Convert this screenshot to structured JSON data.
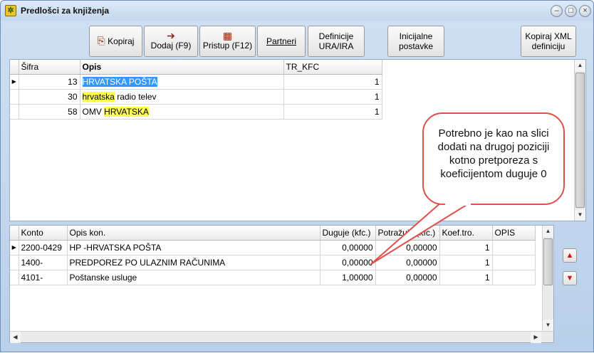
{
  "window": {
    "title": "Predlošci za knjiženja"
  },
  "toolbar": {
    "kopiraj": "Kopiraj",
    "dodaj": "Dodaj (F9)",
    "pristup": "Pristup (F12)",
    "partneri": "Partneri",
    "definicije_1": "Definicije",
    "definicije_2": "URA/IRA",
    "inicijalne_1": "Inicijalne",
    "inicijalne_2": "postavke",
    "kopiraj_xml_1": "Kopiraj XML",
    "kopiraj_xml_2": "definiciju"
  },
  "top_grid": {
    "columns": [
      "Šifra",
      "Opis",
      "TR_KFC"
    ],
    "rows": [
      {
        "sifra": "13",
        "opis": "HRVATSKA POŠTA",
        "opis_hl": "HRVATSKA POŠTA",
        "opis_rest": "",
        "tr_kfc": "1",
        "current": true
      },
      {
        "sifra": "30",
        "opis": "hrvatska radio telev",
        "opis_pre": "",
        "opis_hl": "hrvatska",
        "opis_rest": " radio telev",
        "tr_kfc": "1"
      },
      {
        "sifra": "58",
        "opis": "OMV HRVATSKA",
        "opis_pre": "OMV ",
        "opis_hl": "HRVATSKA",
        "opis_rest": "",
        "tr_kfc": "1"
      }
    ]
  },
  "bottom_grid": {
    "columns": [
      "Konto",
      "Opis kon.",
      "Duguje (kfc.)",
      "Potražuje (kfc.)",
      "Koef.tro.",
      "OPIS"
    ],
    "rows": [
      {
        "konto": "2200-0429",
        "opis": "HP -HRVATSKA POŠTA",
        "duguje": "0,00000",
        "potrazuje": "0,00000",
        "koef": "1",
        "opis2": ""
      },
      {
        "konto": "1400-",
        "opis": "PREDPOREZ PO ULAZNIM RAČUNIMA",
        "duguje": "0,00000",
        "potrazuje": "0,00000",
        "koef": "1",
        "opis2": ""
      },
      {
        "konto": "4101-",
        "opis": "Poštanske usluge",
        "duguje": "1,00000",
        "potrazuje": "0,00000",
        "koef": "1",
        "opis2": ""
      }
    ]
  },
  "callout": {
    "text": "Potrebno je kao na slici dodati na drugoj poziciji kotno pretporeza s koeficijentom duguje 0"
  },
  "colors": {
    "accent_border": "#e0504a",
    "selection": "#3399ff",
    "search_highlight": "#ffff55"
  }
}
